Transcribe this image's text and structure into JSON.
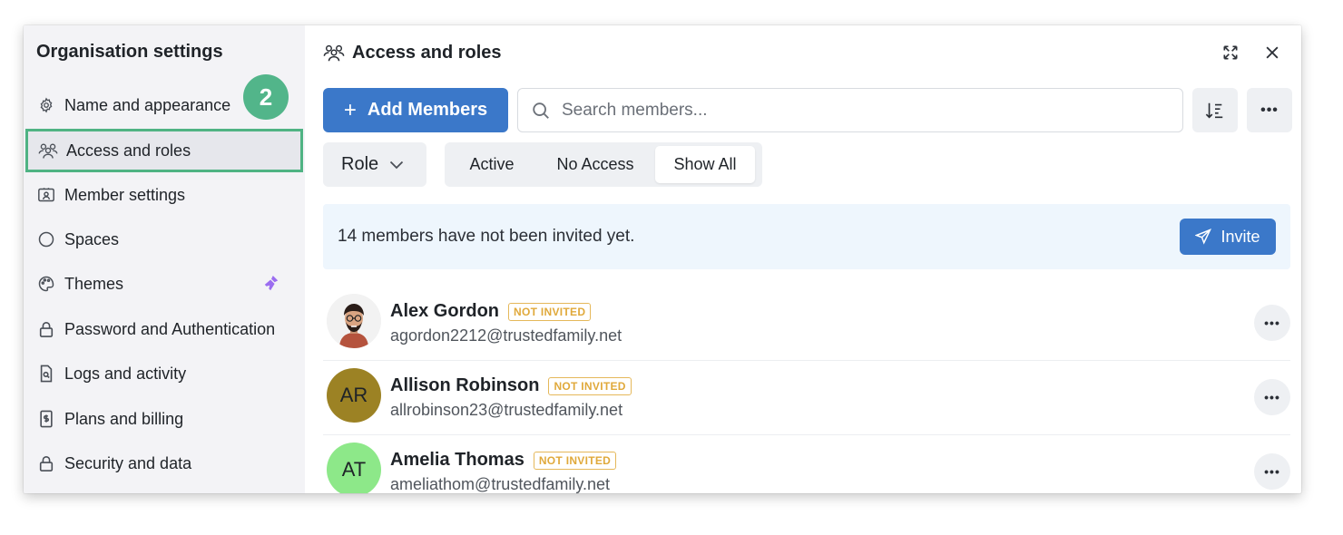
{
  "sidebar": {
    "title": "Organisation settings",
    "items": [
      {
        "label": "Name and appearance",
        "icon": "gear-icon"
      },
      {
        "label": "Access and roles",
        "icon": "users-icon"
      },
      {
        "label": "Member settings",
        "icon": "member-card-icon"
      },
      {
        "label": "Spaces",
        "icon": "circle-icon"
      },
      {
        "label": "Themes",
        "icon": "palette-icon"
      },
      {
        "label": "Password and Authentication",
        "icon": "lock-icon"
      },
      {
        "label": "Logs and activity",
        "icon": "document-search-icon"
      },
      {
        "label": "Plans and billing",
        "icon": "receipt-icon"
      },
      {
        "label": "Security and data",
        "icon": "lock-icon"
      }
    ],
    "active_index": 1
  },
  "step_badge": "2",
  "header": {
    "title": "Access and roles",
    "icon": "users-icon"
  },
  "toolbar": {
    "add_members_label": "Add Members",
    "search_placeholder": "Search members...",
    "more_label": "•••"
  },
  "filters": {
    "role_label": "Role",
    "status_options": [
      "Active",
      "No Access",
      "Show All"
    ],
    "selected_status": "Show All"
  },
  "banner": {
    "message": "14 members have not been invited yet.",
    "invite_label": "Invite"
  },
  "members": [
    {
      "name": "Alex Gordon",
      "email": "agordon2212@trustedfamily.net",
      "status": "NOT INVITED",
      "initials": "",
      "avatar_color": "#f2f2f2"
    },
    {
      "name": "Allison Robinson",
      "email": "allrobinson23@trustedfamily.net",
      "status": "NOT INVITED",
      "initials": "AR",
      "avatar_color": "#9c8224"
    },
    {
      "name": "Amelia Thomas",
      "email": "ameliathom@trustedfamily.net",
      "status": "NOT INVITED",
      "initials": "AT",
      "avatar_color": "#8de889"
    }
  ],
  "row_more_label": "•••",
  "colors": {
    "accent": "#3b78c9",
    "highlight": "#4fb383",
    "badge": "#e0a93b",
    "banner_bg": "#eef6fd",
    "sidebar_bg": "#f3f3f6"
  }
}
